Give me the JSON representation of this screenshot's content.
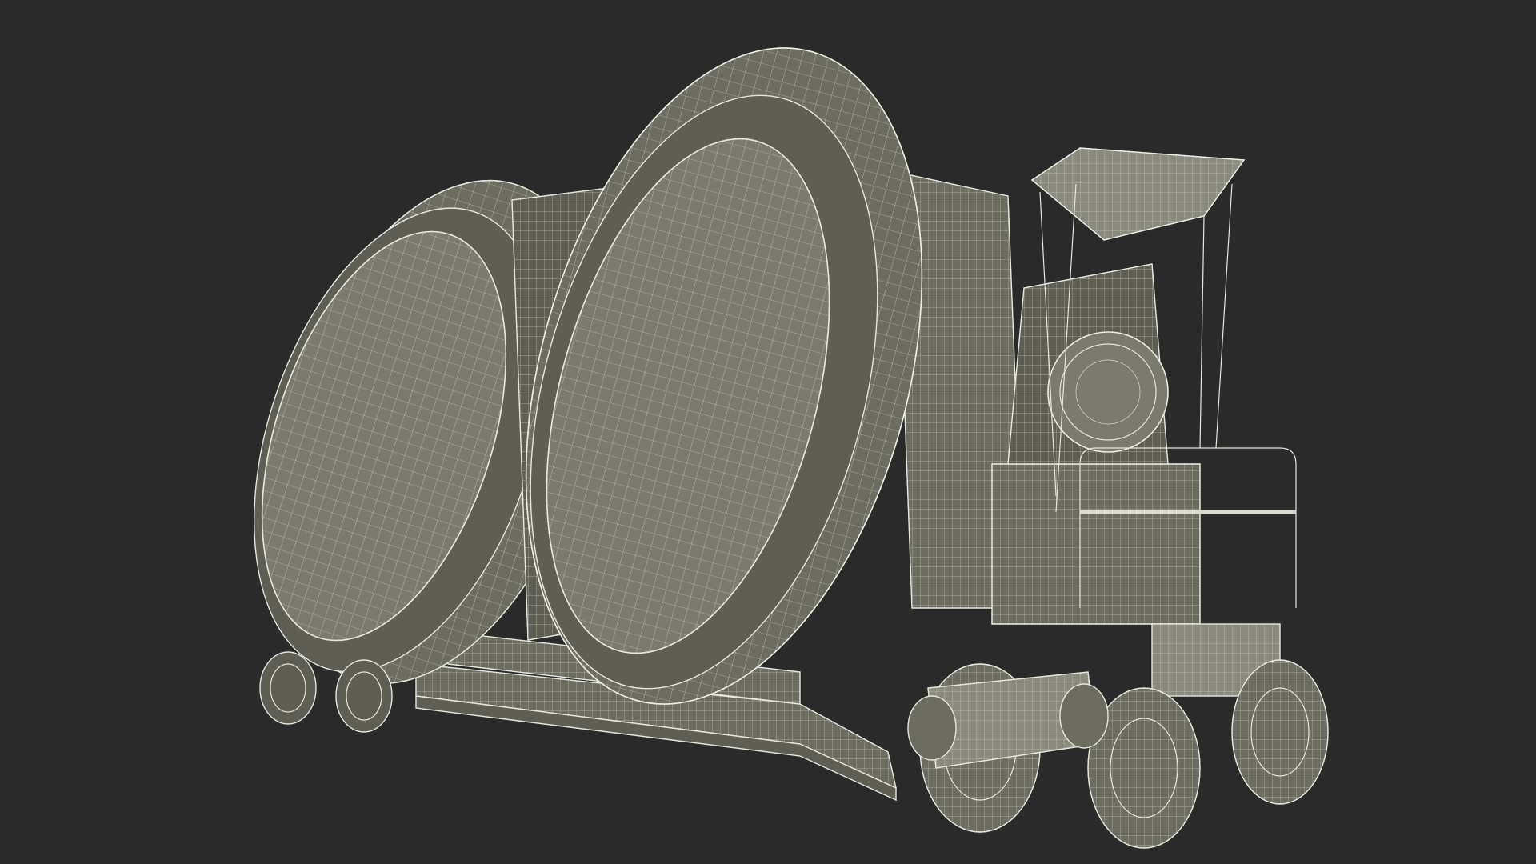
{
  "scene": {
    "subject": "wireframe-3d-model",
    "background_color": "#2a2a2a",
    "wire_color": "#e6e6dc",
    "surface_color": "#7a7a6e"
  }
}
